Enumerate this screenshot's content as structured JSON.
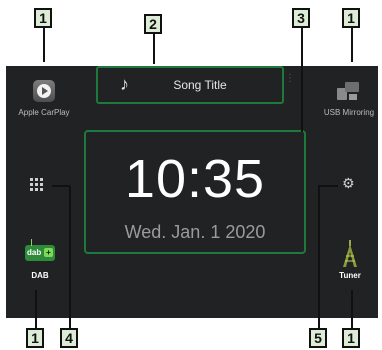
{
  "callouts": {
    "c1_top_left": "1",
    "c2_top": "2",
    "c3_top": "3",
    "c1_top_right": "1",
    "c1_bottom_left": "1",
    "c4_bottom": "4",
    "c5_bottom": "5",
    "c1_bottom_right": "1"
  },
  "apps": {
    "apple_carplay": "Apple CarPlay",
    "usb_mirroring": "USB Mirroring",
    "dab": "DAB",
    "tuner": "Tuner"
  },
  "now_playing": {
    "song_title": "Song Title",
    "note_glyph": "♪"
  },
  "clock": {
    "time": "10:35",
    "date": "Wed. Jan.  1  2020"
  },
  "icons": {
    "menu": "grid-icon",
    "settings": "gear-icon",
    "dab_badge_text": "dab",
    "dab_badge_plus": "+"
  },
  "colors": {
    "screen_bg": "#202223",
    "callout_fill": "#dcecd6",
    "highlight_border": "#1e7a3c",
    "dab_green": "#2e8b3a"
  }
}
